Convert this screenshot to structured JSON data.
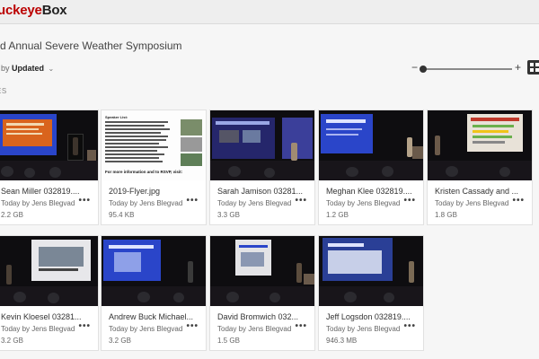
{
  "app": {
    "logo_part1": "uckeye",
    "logo_part2": "Box"
  },
  "folder": {
    "title": "rd Annual Severe Weather Symposium"
  },
  "sort": {
    "prefix": "t by",
    "value": "Updated",
    "chevron": "⌄"
  },
  "zoom": {
    "minus": "−",
    "plus": "+",
    "level": 0.0
  },
  "section": {
    "label": "ES"
  },
  "icons": {
    "more": "more-options-icon",
    "grid": "grid-view-icon",
    "chevron": "chevron-down-icon"
  },
  "files": [
    {
      "name": "Sean Miller 032819....",
      "meta": "Today by Jens Blegvad",
      "size": "2.2 GB"
    },
    {
      "name": "2019-Flyer.jpg",
      "meta": "Today by Jens Blegvad",
      "size": "95.4 KB"
    },
    {
      "name": "Sarah Jamison 03281...",
      "meta": "Today by Jens Blegvad",
      "size": "3.3 GB"
    },
    {
      "name": "Meghan Klee 032819....",
      "meta": "Today by Jens Blegvad",
      "size": "1.2 GB"
    },
    {
      "name": "Kristen Cassady and ...",
      "meta": "Today by Jens Blegvad",
      "size": "1.8 GB"
    },
    {
      "name": "Kevin Kloesel 03281...",
      "meta": "Today by Jens Blegvad",
      "size": "3.2 GB"
    },
    {
      "name": "Andrew Buck Michael...",
      "meta": "Today by Jens Blegvad",
      "size": "3.2 GB"
    },
    {
      "name": "David Bromwich 032...",
      "meta": "Today by Jens Blegvad",
      "size": "1.5 GB"
    },
    {
      "name": "Jeff Logsdon 032819....",
      "meta": "Today by Jens Blegvad",
      "size": "946.3 MB"
    }
  ],
  "flyer": {
    "heading": "Speaker List:",
    "footer": "For more information and to RSVP, visit:"
  },
  "colors": {
    "brand_red": "#bb0000",
    "slide_blue": "#2a45c9",
    "slide_orange": "#d9641d"
  }
}
